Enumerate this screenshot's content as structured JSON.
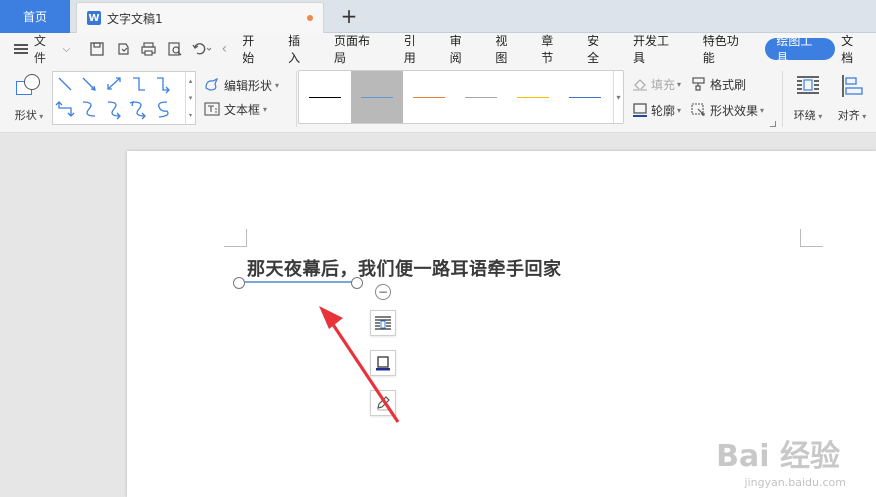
{
  "tabs": {
    "home": "首页",
    "doc_icon": "W",
    "doc_title": "文字文稿1",
    "new_tab": "+"
  },
  "menu": {
    "file": "文件",
    "items": [
      "开始",
      "插入",
      "页面布局",
      "引用",
      "审阅",
      "视图",
      "章节",
      "安全",
      "开发工具",
      "特色功能",
      "绘图工具",
      "文档"
    ],
    "active_index": 10
  },
  "ribbon": {
    "shapes": "形状",
    "edit_shape": "编辑形状",
    "textbox": "文本框",
    "fill": "填充",
    "format_painter": "格式刷",
    "outline": "轮廓",
    "shape_effects": "形状效果",
    "wrap": "环绕",
    "align": "对齐",
    "line_styles": [
      {
        "color": "#000000",
        "selected": false
      },
      {
        "color": "#5b9bd5",
        "selected": true
      },
      {
        "color": "#ed7d31",
        "selected": false
      },
      {
        "color": "#a5a5a5",
        "selected": false
      },
      {
        "color": "#ffc000",
        "selected": false
      },
      {
        "color": "#4472c4",
        "selected": false
      }
    ]
  },
  "document": {
    "text": "那天夜幕后，我们便一路耳语牵手回家",
    "collapse_symbol": "−"
  },
  "watermark": {
    "brand": "Bai 经验",
    "url": "jingyan.baidu.com"
  },
  "colors": {
    "accent": "#3d7fe0",
    "arrow": "#e8333a"
  }
}
